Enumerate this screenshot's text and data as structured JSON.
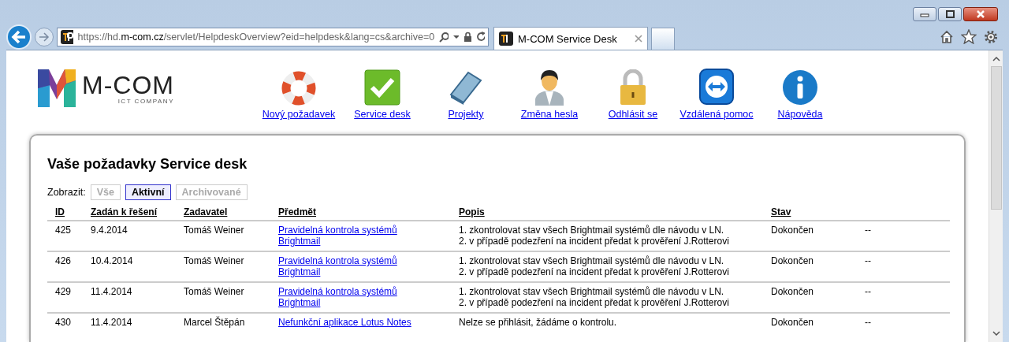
{
  "browser": {
    "address": {
      "host_prefix": "https://hd.",
      "host": "m-com.cz",
      "path": "/servlet/HelpdeskOverview?eid=helpdesk&lang=cs&archive=0"
    },
    "tabs": [
      {
        "title": "M-COM Service Desk",
        "selected": true
      }
    ]
  },
  "logo": {
    "name": "M-COM",
    "tagline": "ICT COMPANY"
  },
  "nav": [
    {
      "label": "Nový požadavek",
      "kind": "lifebuoy"
    },
    {
      "label": "Service desk",
      "kind": "check"
    },
    {
      "label": "Projekty",
      "kind": "book"
    },
    {
      "label": "Změna hesla",
      "kind": "user"
    },
    {
      "label": "Odhlásit se",
      "kind": "lock"
    },
    {
      "label": "Vzdálená pomoc",
      "kind": "remote"
    },
    {
      "label": "Nápověda",
      "kind": "info"
    }
  ],
  "page_title": "Vaše požadavky Service desk",
  "filter": {
    "label": "Zobrazit:",
    "options": [
      {
        "label": "Vše",
        "selected": false
      },
      {
        "label": "Aktivní",
        "selected": true
      },
      {
        "label": "Archivované",
        "selected": false
      }
    ]
  },
  "table": {
    "columns": [
      "ID",
      "Zadán k řešení",
      "Zadavatel",
      "Předmět",
      "Popis",
      "Stav"
    ],
    "rows": [
      {
        "id": "425",
        "date": "9.4.2014",
        "requester": "Tomáš Weiner",
        "subject": "Pravidelná kontrola systémů Brightmail",
        "description": [
          "1. zkontrolovat stav všech Brightmail systémů dle návodu v LN.",
          "2. v případě podezření na incident předat k prověření J.Rotterovi"
        ],
        "status": "Dokončen",
        "column_7": "--"
      },
      {
        "id": "426",
        "date": "10.4.2014",
        "requester": "Tomáš Weiner",
        "subject": "Pravidelná kontrola systémů Brightmail",
        "description": [
          "1. zkontrolovat stav všech Brightmail systémů dle návodu v LN.",
          "2. v případě podezření na incident předat k prověření J.Rotterovi"
        ],
        "status": "Dokončen",
        "column_7": "--"
      },
      {
        "id": "429",
        "date": "11.4.2014",
        "requester": "Tomáš Weiner",
        "subject": "Pravidelná kontrola systémů Brightmail",
        "description": [
          "1. zkontrolovat stav všech Brightmail systémů dle návodu v LN.",
          "2. v případě podezření na incident předat k prověření J.Rotterovi"
        ],
        "status": "Dokončen",
        "column_7": "--"
      },
      {
        "id": "430",
        "date": "11.4.2014",
        "requester": "Marcel Štěpán",
        "subject": "Nefunkční aplikace Lotus Notes",
        "description": [
          "Nelze se přihlásit, žádáme o kontrolu."
        ],
        "status": "Dokončen",
        "column_7": "--"
      }
    ]
  }
}
